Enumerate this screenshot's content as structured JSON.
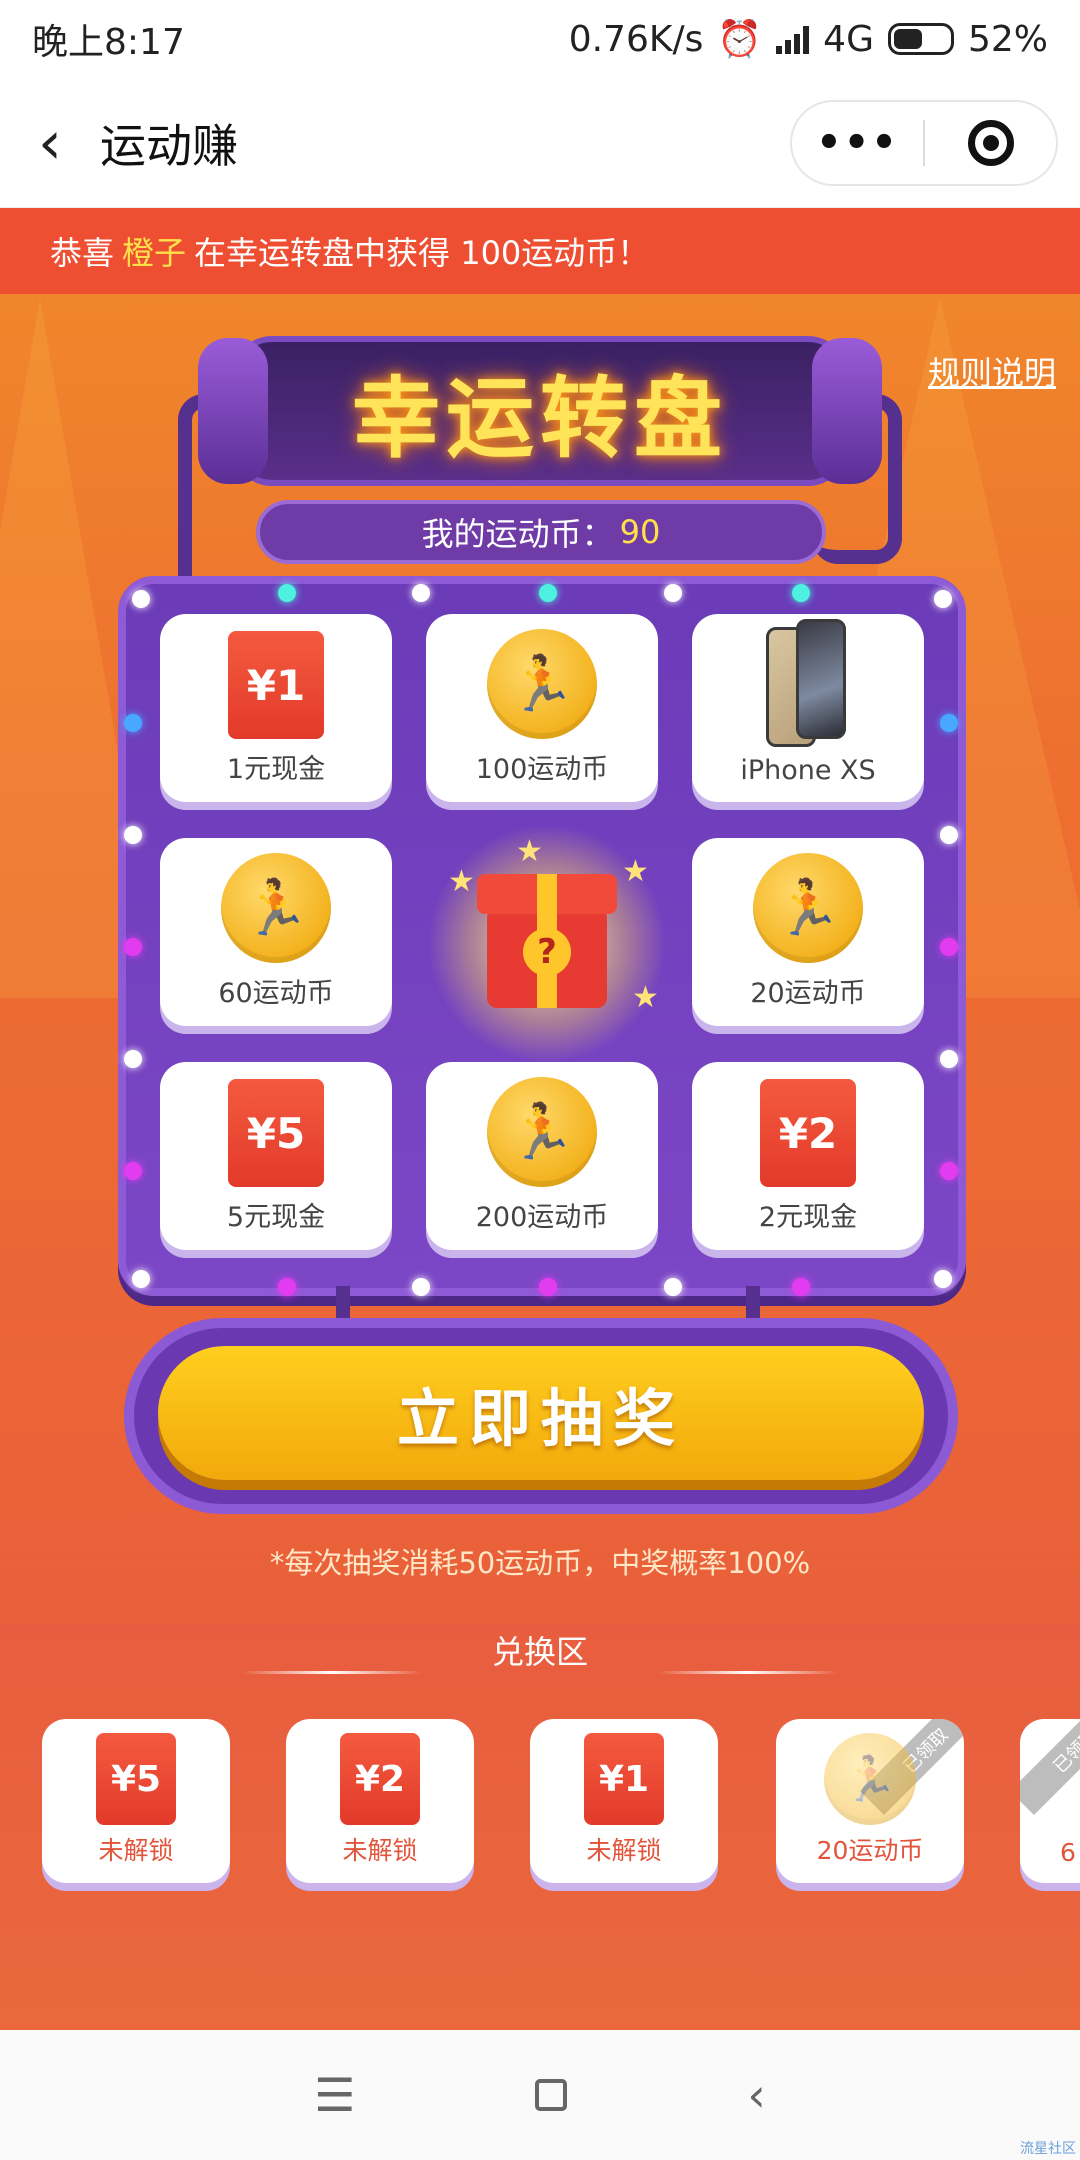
{
  "status_bar": {
    "time": "晚上8:17",
    "speed": "0.76K/s",
    "network": "4G",
    "battery": "52%"
  },
  "app_bar": {
    "title": "运动赚",
    "more_label": "•••"
  },
  "notice": {
    "prefix": "恭喜",
    "name": "橙子",
    "suffix": "在幸运转盘中获得 100运动币！"
  },
  "rules_link": "规则说明",
  "banner_title": "幸运转盘",
  "coins": {
    "label": "我的运动币：",
    "value": "90"
  },
  "prizes": [
    {
      "type": "redpack",
      "icon_text": "¥1",
      "label": "1元现金"
    },
    {
      "type": "coin",
      "icon_text": "🏃",
      "label": "100运动币"
    },
    {
      "type": "phone",
      "icon_text": "",
      "label": "iPhone XS"
    },
    {
      "type": "coin",
      "icon_text": "🏃",
      "label": "60运动币"
    },
    {
      "type": "coin",
      "icon_text": "🏃",
      "label": "20运动币"
    },
    {
      "type": "redpack",
      "icon_text": "¥5",
      "label": "5元现金"
    },
    {
      "type": "coin",
      "icon_text": "🏃",
      "label": "200运动币"
    },
    {
      "type": "redpack",
      "icon_text": "¥2",
      "label": "2元现金"
    }
  ],
  "gift_symbol": "?",
  "draw_button": "立即抽奖",
  "draw_note": "*每次抽奖消耗50运动币，中奖概率100%",
  "exchange": {
    "title": "兑换区",
    "items": [
      {
        "icon_text": "¥5",
        "label": "未解锁"
      },
      {
        "icon_text": "¥2",
        "label": "未解锁"
      },
      {
        "icon_text": "¥1",
        "label": "未解锁"
      },
      {
        "icon_text": "🏃",
        "label": "20运动币",
        "ribbon": "已领取"
      },
      {
        "icon_text": "🏃",
        "label": "6",
        "ribbon": "已领取"
      }
    ]
  },
  "nav": {
    "menu": "☰",
    "back": "‹"
  },
  "watermark": "流星社区"
}
